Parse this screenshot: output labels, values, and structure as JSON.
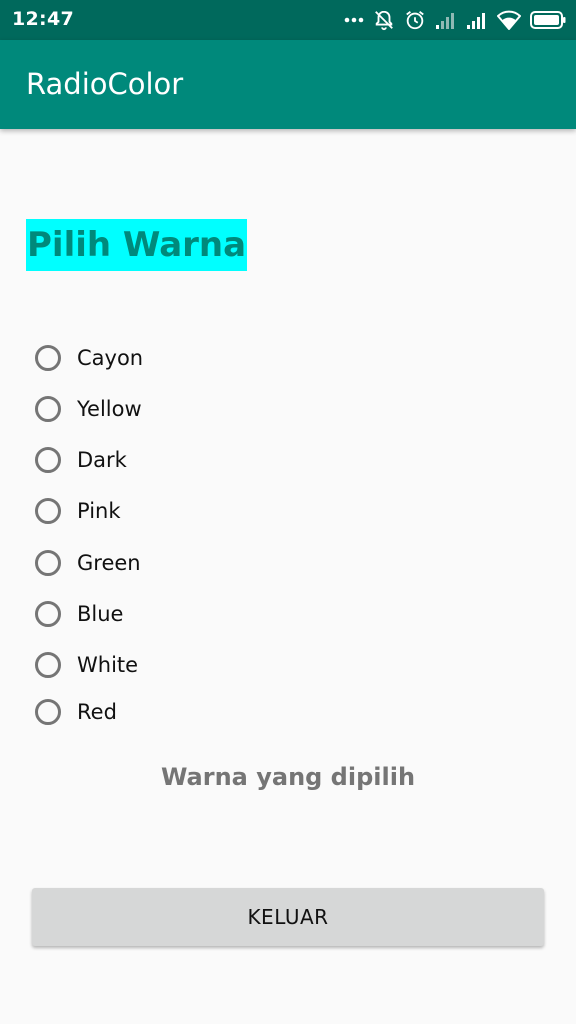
{
  "status_bar": {
    "time": "12:47",
    "icons": [
      "more-dots-icon",
      "notifications-off-icon",
      "alarm-icon",
      "signal-weak-icon",
      "signal-full-icon",
      "wifi-icon",
      "battery-icon"
    ]
  },
  "app_bar": {
    "title": "RadioColor"
  },
  "heading": {
    "text": "Pilih Warna",
    "background_color": "#00ffff",
    "text_color": "#00897b"
  },
  "radio_group": {
    "options": [
      {
        "label": "Cayon",
        "selected": false
      },
      {
        "label": "Yellow",
        "selected": false
      },
      {
        "label": "Dark",
        "selected": false
      },
      {
        "label": "Pink",
        "selected": false
      },
      {
        "label": "Green",
        "selected": false
      },
      {
        "label": "Blue",
        "selected": false
      },
      {
        "label": "White",
        "selected": false
      },
      {
        "label": "Red",
        "selected": false
      }
    ]
  },
  "result": {
    "text": "Warna yang dipilih"
  },
  "exit_button": {
    "label": "KELUAR"
  },
  "colors": {
    "primary": "#00897b",
    "primary_dark": "#00695c",
    "background": "#fafafa",
    "button": "#d6d7d7"
  }
}
